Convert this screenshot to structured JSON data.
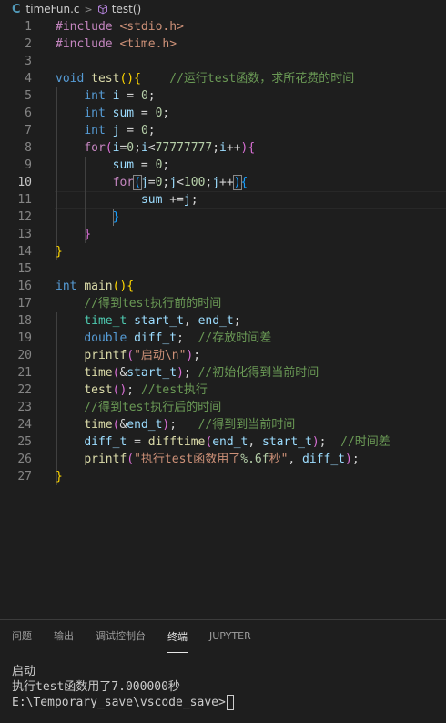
{
  "breadcrumb": {
    "file_icon": "C",
    "file": "timeFun.c",
    "symbol": "test()"
  },
  "editor": {
    "active_line": 10,
    "lines": [
      {
        "n": "1",
        "t": [
          [
            "ctl",
            "#include "
          ],
          [
            "str",
            "<stdio.h>"
          ]
        ]
      },
      {
        "n": "2",
        "t": [
          [
            "ctl",
            "#include "
          ],
          [
            "str",
            "<time.h>"
          ]
        ]
      },
      {
        "n": "3",
        "t": []
      },
      {
        "n": "4",
        "t": [
          [
            "kw",
            "void "
          ],
          [
            "fn",
            "test"
          ],
          [
            "br1",
            "()"
          ],
          [
            "br1",
            "{"
          ],
          [
            "plain",
            "    "
          ],
          [
            "cmt",
            "//运行test函数，求所花费的时间"
          ]
        ]
      },
      {
        "n": "5",
        "t": [
          [
            "plain",
            "    "
          ],
          [
            "kw",
            "int "
          ],
          [
            "var",
            "i"
          ],
          [
            "plain",
            " = "
          ],
          [
            "num",
            "0"
          ],
          [
            "plain",
            ";"
          ]
        ]
      },
      {
        "n": "6",
        "t": [
          [
            "plain",
            "    "
          ],
          [
            "kw",
            "int "
          ],
          [
            "var",
            "sum"
          ],
          [
            "plain",
            " = "
          ],
          [
            "num",
            "0"
          ],
          [
            "plain",
            ";"
          ]
        ]
      },
      {
        "n": "7",
        "t": [
          [
            "plain",
            "    "
          ],
          [
            "kw",
            "int "
          ],
          [
            "var",
            "j"
          ],
          [
            "plain",
            " = "
          ],
          [
            "num",
            "0"
          ],
          [
            "plain",
            ";"
          ]
        ]
      },
      {
        "n": "8",
        "t": [
          [
            "plain",
            "    "
          ],
          [
            "ctl",
            "for"
          ],
          [
            "br2",
            "("
          ],
          [
            "var",
            "i"
          ],
          [
            "plain",
            "="
          ],
          [
            "num",
            "0"
          ],
          [
            "plain",
            ";"
          ],
          [
            "var",
            "i"
          ],
          [
            "plain",
            "<"
          ],
          [
            "num",
            "77777777"
          ],
          [
            "plain",
            ";"
          ],
          [
            "var",
            "i"
          ],
          [
            "plain",
            "++"
          ],
          [
            "br2",
            ")"
          ],
          [
            "br2",
            "{"
          ]
        ]
      },
      {
        "n": "9",
        "t": [
          [
            "plain",
            "        "
          ],
          [
            "var",
            "sum"
          ],
          [
            "plain",
            " = "
          ],
          [
            "num",
            "0"
          ],
          [
            "plain",
            ";"
          ]
        ]
      },
      {
        "n": "10",
        "t": [
          [
            "plain",
            "        "
          ],
          [
            "ctl",
            "for"
          ],
          [
            "br3hl",
            "("
          ],
          [
            "var",
            "j"
          ],
          [
            "plain",
            "="
          ],
          [
            "num",
            "0"
          ],
          [
            "plain",
            ";"
          ],
          [
            "var",
            "j"
          ],
          [
            "plain",
            "<"
          ],
          [
            "num",
            "10"
          ],
          [
            "caret",
            ""
          ],
          [
            "num",
            "0"
          ],
          [
            "plain",
            ";"
          ],
          [
            "var",
            "j"
          ],
          [
            "plain",
            "++"
          ],
          [
            "br3hl",
            ")"
          ],
          [
            "br3",
            "{"
          ]
        ]
      },
      {
        "n": "11",
        "t": [
          [
            "plain",
            "            "
          ],
          [
            "var",
            "sum"
          ],
          [
            "plain",
            " +="
          ],
          [
            "var",
            "j"
          ],
          [
            "plain",
            ";"
          ]
        ]
      },
      {
        "n": "12",
        "t": [
          [
            "plain",
            "        "
          ],
          [
            "br3",
            "}"
          ]
        ]
      },
      {
        "n": "13",
        "t": [
          [
            "plain",
            "    "
          ],
          [
            "br2",
            "}"
          ]
        ]
      },
      {
        "n": "14",
        "t": [
          [
            "br1",
            "}"
          ]
        ]
      },
      {
        "n": "15",
        "t": []
      },
      {
        "n": "16",
        "t": [
          [
            "kw",
            "int "
          ],
          [
            "fn",
            "main"
          ],
          [
            "br1",
            "()"
          ],
          [
            "br1",
            "{"
          ]
        ]
      },
      {
        "n": "17",
        "t": [
          [
            "plain",
            "    "
          ],
          [
            "cmt",
            "//得到test执行前的时间"
          ]
        ]
      },
      {
        "n": "18",
        "t": [
          [
            "plain",
            "    "
          ],
          [
            "typ",
            "time_t "
          ],
          [
            "var",
            "start_t"
          ],
          [
            "plain",
            ", "
          ],
          [
            "var",
            "end_t"
          ],
          [
            "plain",
            ";"
          ]
        ]
      },
      {
        "n": "19",
        "t": [
          [
            "plain",
            "    "
          ],
          [
            "kw",
            "double "
          ],
          [
            "var",
            "diff_t"
          ],
          [
            "plain",
            ";  "
          ],
          [
            "cmt",
            "//存放时间差"
          ]
        ]
      },
      {
        "n": "20",
        "t": [
          [
            "plain",
            "    "
          ],
          [
            "fn",
            "printf"
          ],
          [
            "br2",
            "("
          ],
          [
            "str",
            "\"启动\\n\""
          ],
          [
            "br2",
            ")"
          ],
          [
            "plain",
            ";"
          ]
        ]
      },
      {
        "n": "21",
        "t": [
          [
            "plain",
            "    "
          ],
          [
            "fn",
            "time"
          ],
          [
            "br2",
            "("
          ],
          [
            "plain",
            "&"
          ],
          [
            "var",
            "start_t"
          ],
          [
            "br2",
            ")"
          ],
          [
            "plain",
            "; "
          ],
          [
            "cmt",
            "//初始化得到当前时间"
          ]
        ]
      },
      {
        "n": "22",
        "t": [
          [
            "plain",
            "    "
          ],
          [
            "fn",
            "test"
          ],
          [
            "br2",
            "()"
          ],
          [
            "plain",
            "; "
          ],
          [
            "cmt",
            "//test执行"
          ]
        ]
      },
      {
        "n": "23",
        "t": [
          [
            "plain",
            "    "
          ],
          [
            "cmt",
            "//得到test执行后的时间"
          ]
        ]
      },
      {
        "n": "24",
        "t": [
          [
            "plain",
            "    "
          ],
          [
            "fn",
            "time"
          ],
          [
            "br2",
            "("
          ],
          [
            "plain",
            "&"
          ],
          [
            "var",
            "end_t"
          ],
          [
            "br2",
            ")"
          ],
          [
            "plain",
            ";   "
          ],
          [
            "cmt",
            "//得到到当前时间"
          ]
        ]
      },
      {
        "n": "25",
        "t": [
          [
            "plain",
            "    "
          ],
          [
            "var",
            "diff_t"
          ],
          [
            "plain",
            " = "
          ],
          [
            "fn",
            "difftime"
          ],
          [
            "br2",
            "("
          ],
          [
            "var",
            "end_t"
          ],
          [
            "plain",
            ", "
          ],
          [
            "var",
            "start_t"
          ],
          [
            "br2",
            ")"
          ],
          [
            "plain",
            ";  "
          ],
          [
            "cmt",
            "//时间差"
          ]
        ]
      },
      {
        "n": "26",
        "t": [
          [
            "plain",
            "    "
          ],
          [
            "fn",
            "printf"
          ],
          [
            "br2",
            "("
          ],
          [
            "str",
            "\"执行test函数用了"
          ],
          [
            "num",
            "%.6f"
          ],
          [
            "str",
            "秒\""
          ],
          [
            "plain",
            ", "
          ],
          [
            "var",
            "diff_t"
          ],
          [
            "br2",
            ")"
          ],
          [
            "plain",
            ";"
          ]
        ]
      },
      {
        "n": "27",
        "t": [
          [
            "br1",
            "}"
          ]
        ]
      }
    ]
  },
  "panel": {
    "tabs": [
      "问题",
      "输出",
      "调试控制台",
      "终端",
      "JUPYTER"
    ],
    "active_tab": "终端",
    "terminal_lines": [
      "启动",
      "执行test函数用了7.000000秒",
      "E:\\Temporary_save\\vscode_save>"
    ]
  },
  "colors": {
    "background": "#1e1e1e",
    "keyword": "#569cd6",
    "control": "#c586c0",
    "function": "#dcdcaa",
    "number": "#b5cea8",
    "string": "#ce9178",
    "variable": "#9cdcfe",
    "comment": "#6a9955",
    "type": "#4ec9b0"
  }
}
